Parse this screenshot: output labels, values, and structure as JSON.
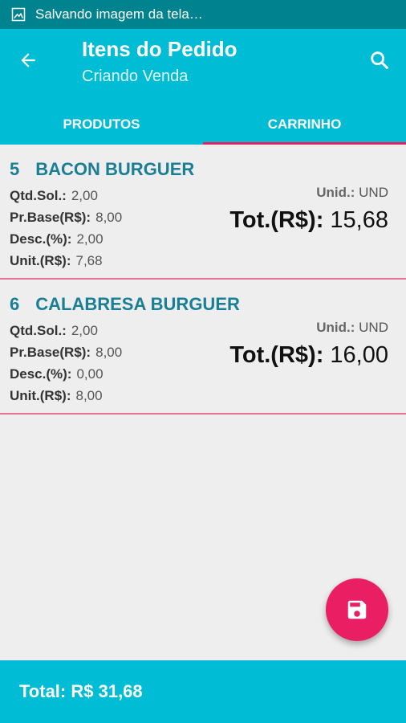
{
  "status_bar": {
    "text": "Salvando imagem da tela…"
  },
  "app_bar": {
    "title": "Itens do Pedido",
    "subtitle": "Criando Venda",
    "tabs": [
      {
        "label": "PRODUTOS",
        "active": false
      },
      {
        "label": "CARRINHO",
        "active": true
      }
    ]
  },
  "items": [
    {
      "code": "5",
      "name": "BACON BURGUER",
      "qtd_label": "Qtd.Sol.:",
      "qtd": "2,00",
      "prbase_label": "Pr.Base(R$):",
      "prbase": "8,00",
      "desc_label": "Desc.(%):",
      "desc": "2,00",
      "unit_label": "Unit.(R$):",
      "unit": "7,68",
      "unid_label": "Unid.:",
      "unid": "UND",
      "tot_label": "Tot.(R$):",
      "tot": "15,68"
    },
    {
      "code": "6",
      "name": "CALABRESA BURGUER",
      "qtd_label": "Qtd.Sol.:",
      "qtd": "2,00",
      "prbase_label": "Pr.Base(R$):",
      "prbase": "8,00",
      "desc_label": "Desc.(%):",
      "desc": "0,00",
      "unit_label": "Unit.(R$):",
      "unit": "8,00",
      "unid_label": "Unid.:",
      "unid": "UND",
      "tot_label": "Tot.(R$):",
      "tot": "16,00"
    }
  ],
  "footer": {
    "total": "Total: R$ 31,68"
  },
  "icons": {
    "status": "image-icon",
    "back": "arrow-back-icon",
    "search": "search-icon",
    "fab": "save-icon"
  },
  "colors": {
    "primary": "#00bcd4",
    "primary_dark": "#00838f",
    "accent": "#e91e63",
    "item_title": "#1a7f95"
  }
}
